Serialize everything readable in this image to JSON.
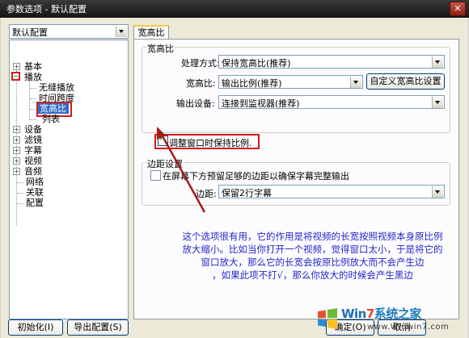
{
  "window": {
    "title": "参数选项 - 默认配置",
    "close_symbol": "✕"
  },
  "profile_select": {
    "value": "默认配置"
  },
  "tree": {
    "items": [
      {
        "expander": "+",
        "label": "基本"
      },
      {
        "expander": "−",
        "label": "播放"
      },
      {
        "label": "无缝播放"
      },
      {
        "label": "时间跨度"
      },
      {
        "label": "宽高比"
      },
      {
        "label": "列表"
      },
      {
        "expander": "+",
        "label": "设备"
      },
      {
        "expander": "+",
        "label": "滤镜"
      },
      {
        "expander": "+",
        "label": "字幕"
      },
      {
        "expander": "+",
        "label": "视频"
      },
      {
        "expander": "+",
        "label": "音频"
      },
      {
        "label": "网络"
      },
      {
        "label": "关联"
      },
      {
        "label": "配置"
      }
    ]
  },
  "tab": {
    "label": "宽高比"
  },
  "aspect_group": {
    "title": "宽高比",
    "processing_label": "处理方式:",
    "processing_value": "保持宽高比(推荐)",
    "ratio_label": "宽高比:",
    "ratio_value": "输出比例(推荐)",
    "custom_button": "自定义宽高比设置",
    "output_label": "输出设备:",
    "output_value": "连接到监视器(推荐)",
    "keep_ratio_checkbox": "调整窗口时保持比例."
  },
  "margin_group": {
    "title": "边距设置",
    "reserve_checkbox": "在屏幕下方预留足够的边距以确保字幕完整输出",
    "margin_label": "边距:",
    "margin_value": "保留2行字幕"
  },
  "annotation": {
    "lines": [
      "这个选项很有用，它的作用是将视频的长宽按照视频本身原比例",
      "放大缩小。比如当你打开一个视频，觉得窗口太小，于是将它的",
      "窗口放大，那么它的长宽会按原比例放大而不会产生边",
      "，如果此项不打√，那么你放大的时候会产生黑边"
    ]
  },
  "bottom": {
    "reset_button": "初始化(I)",
    "export_button": "导出配置(S)",
    "ok_button": "确定(O)",
    "cancel_button": "取消"
  },
  "watermark": {
    "win": "Win",
    "num": "7",
    "suffix": "系统之家",
    "url": "www.Winwin7.com"
  },
  "colors": {
    "highlight_red": "#d21b1b",
    "selection_blue": "#316ac5",
    "annotation_blue": "#2525c8"
  }
}
